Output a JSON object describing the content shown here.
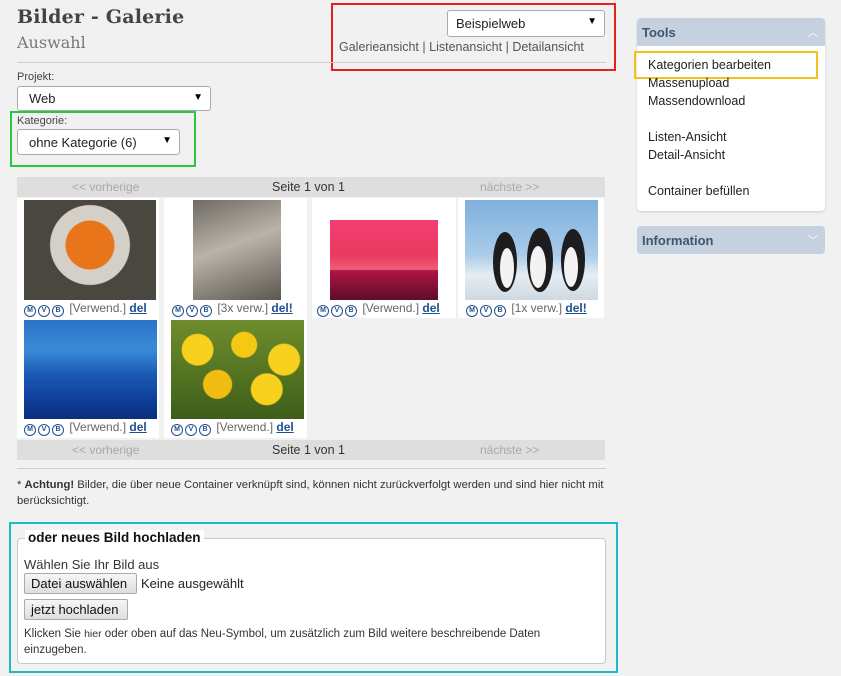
{
  "page": {
    "title": "Bilder - Galerie",
    "subtitle": "Auswahl"
  },
  "website_select": {
    "value": "Beispielweb"
  },
  "views": {
    "gallery": "Galerieansicht",
    "sep": "|",
    "list": "Listenansicht",
    "detail": "Detailansicht"
  },
  "project": {
    "label": "Projekt:",
    "value": "Web"
  },
  "category": {
    "label": "Kategorie:",
    "value": "ohne Kategorie (6)"
  },
  "pager": {
    "prev": "<< vorherige",
    "page": "Seite 1 von 1",
    "next": "nächste >>"
  },
  "icons": {
    "m": "M",
    "v": "V",
    "b": "B"
  },
  "images": [
    {
      "usage": "[Verwend.]",
      "del": "del"
    },
    {
      "usage": "[3x verw.]",
      "del": "del!"
    },
    {
      "usage": "[Verwend.]",
      "del": "del"
    },
    {
      "usage": "[1x verw.]",
      "del": "del!"
    },
    {
      "usage": "[Verwend.]",
      "del": "del"
    },
    {
      "usage": "[Verwend.]",
      "del": "del"
    }
  ],
  "note": {
    "prefix": "* ",
    "bold": "Achtung!",
    "text": " Bilder, die über neue Container verknüpft sind, können nicht zurückverfolgt werden und sind hier nicht mit berücksichtigt."
  },
  "upload": {
    "legend": "oder neues Bild hochladen",
    "choose_label": "Wählen Sie Ihr Bild aus",
    "file_button": "Datei auswählen",
    "file_status": "Keine ausgewählt",
    "upload_button": "jetzt hochladen",
    "hint_prefix": "Klicken Sie ",
    "hint_link": "hier",
    "hint_suffix": " oder oben auf das Neu-Symbol, um zusätzlich zum Bild weitere beschreibende Daten einzugeben."
  },
  "tools": {
    "title": "Tools",
    "items": [
      "Kategorien bearbeiten",
      "Massenupload",
      "Massendownload",
      "Listen-Ansicht",
      "Detail-Ansicht",
      "Container befüllen"
    ]
  },
  "information": {
    "title": "Information"
  },
  "colors": {
    "red_box": "#e2231a",
    "green_box": "#2ec43f",
    "teal_box": "#1bbcc9",
    "yellow_box": "#f4c21a",
    "panel_header": "#c5d1de"
  }
}
